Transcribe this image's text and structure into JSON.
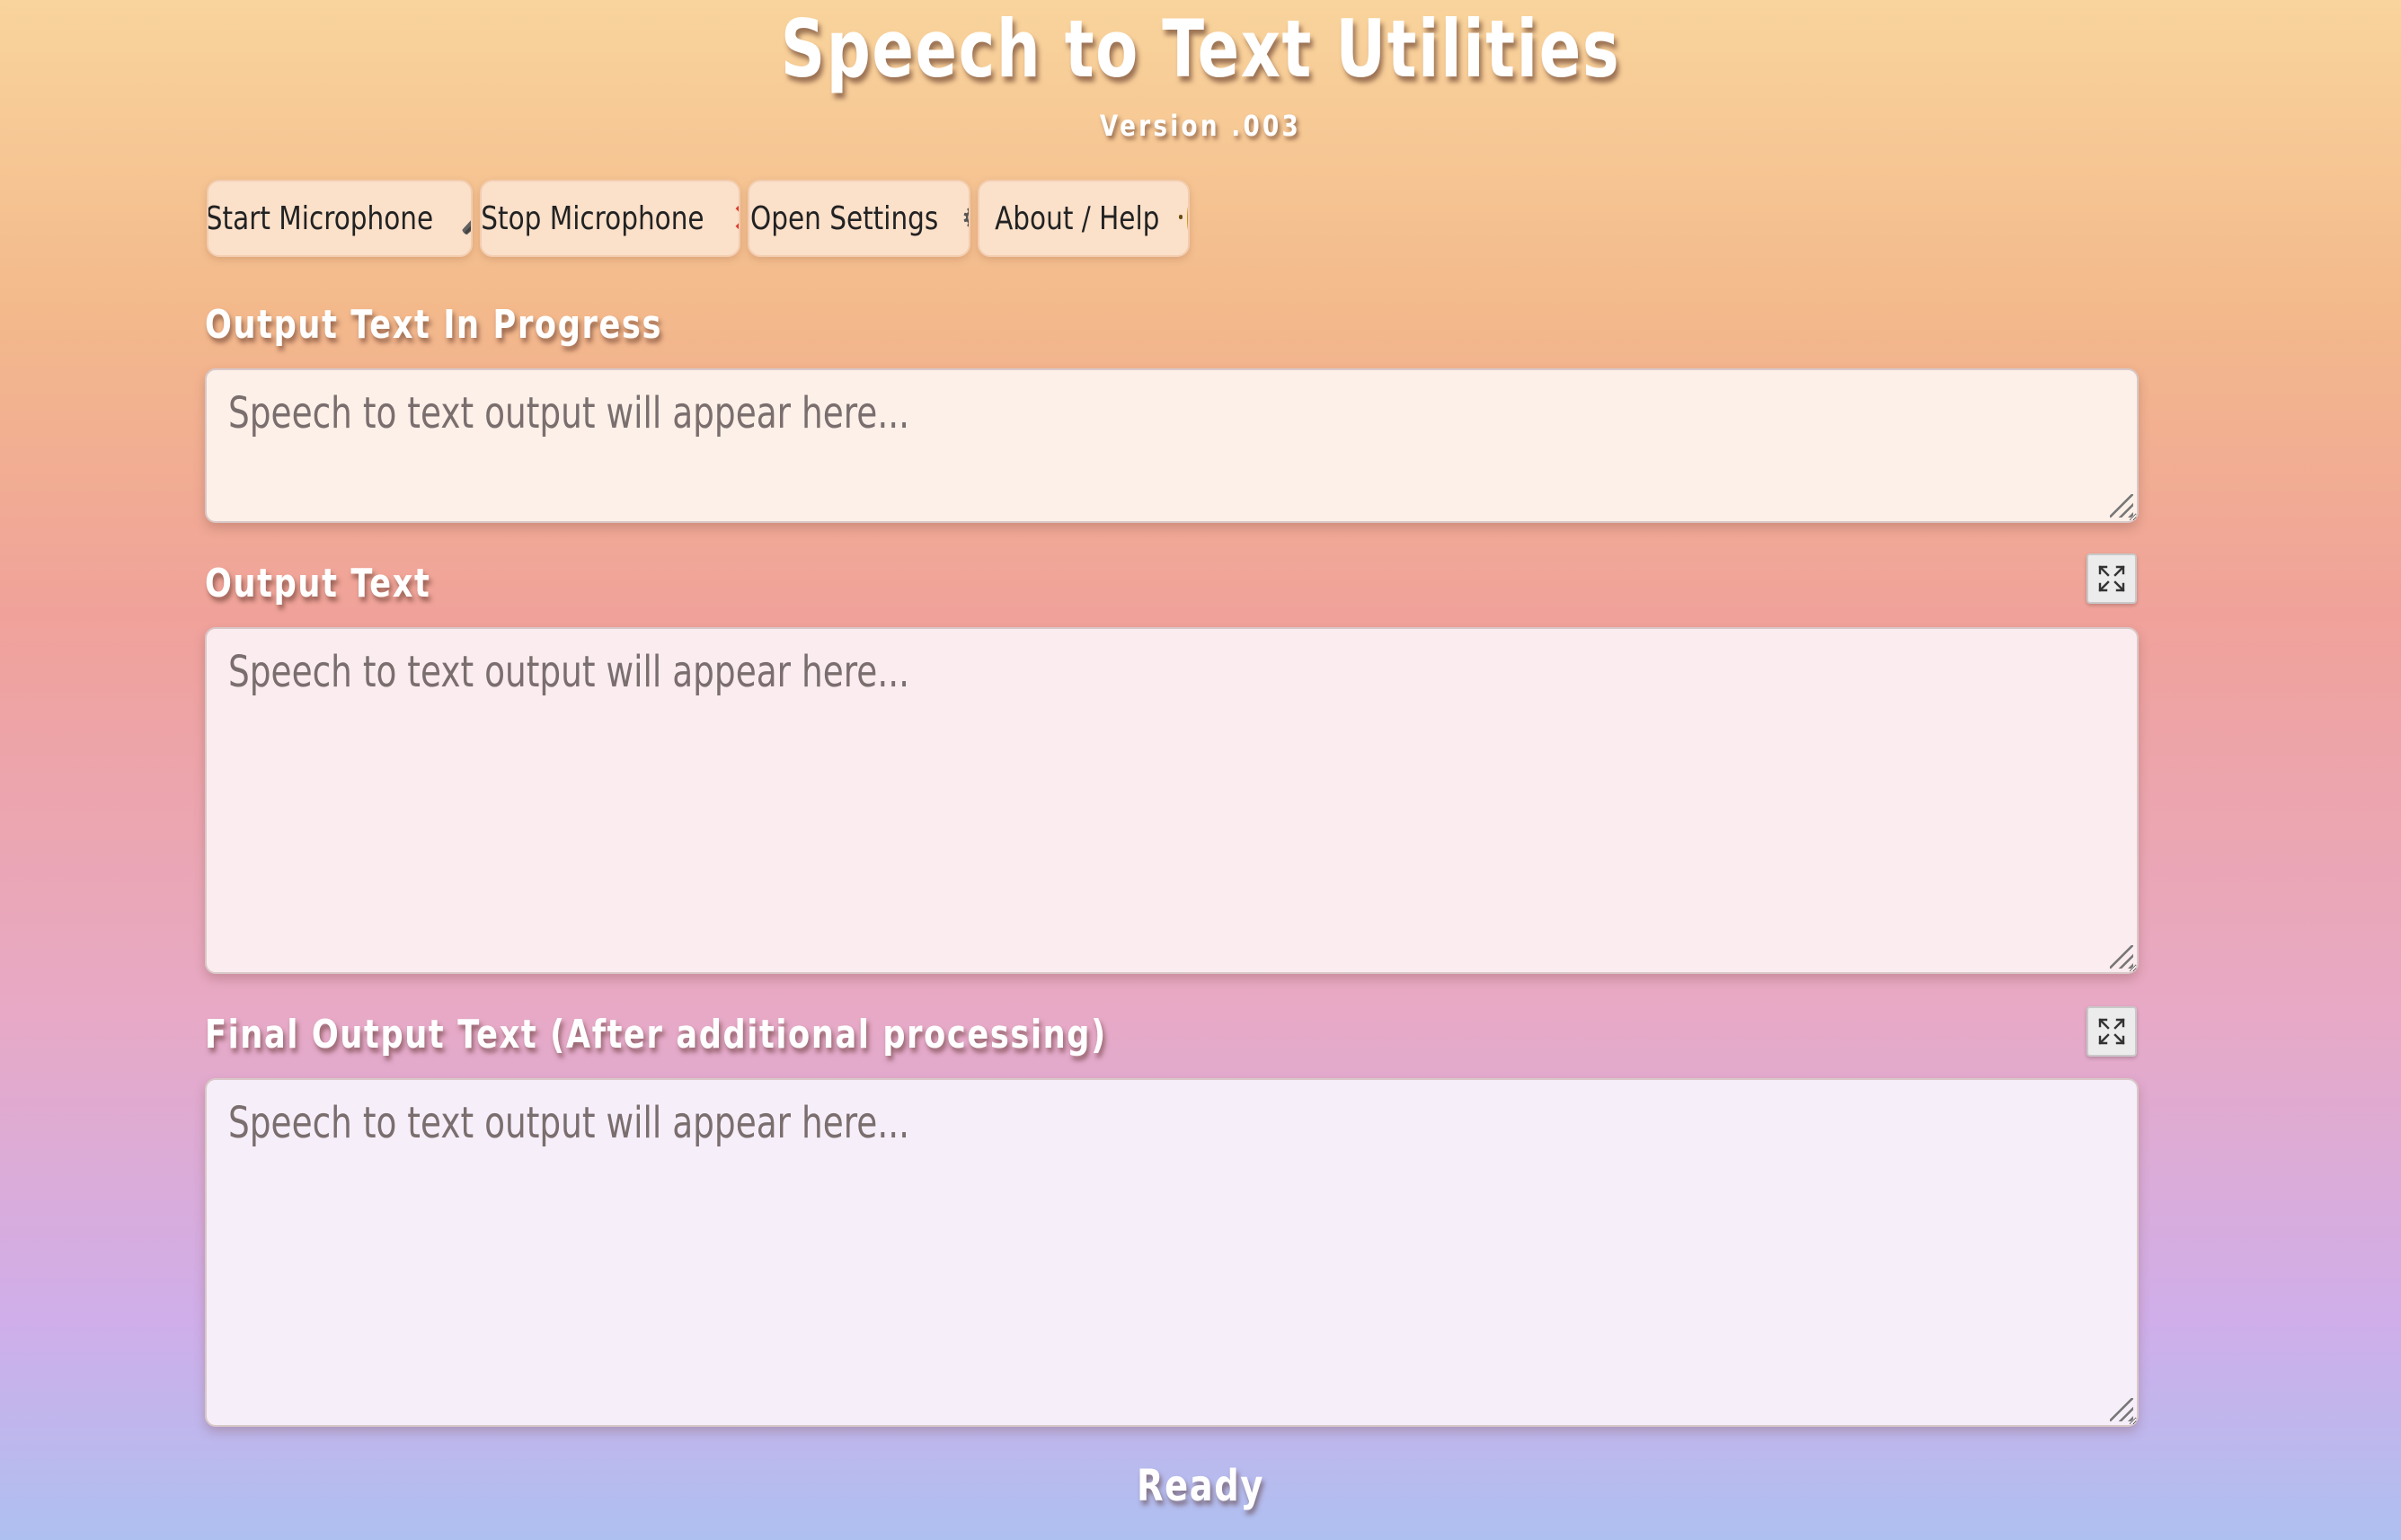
{
  "header": {
    "title": "Speech to Text Utilities",
    "version": "Version .003"
  },
  "toolbar": {
    "buttons": [
      {
        "label": "Start Microphone",
        "icon": "microphone-icon",
        "glyph": "🎤"
      },
      {
        "label": "Stop Microphone",
        "icon": "cross-mark-icon",
        "glyph": "✕"
      },
      {
        "label": "Open Settings",
        "icon": "gear-icon",
        "glyph": "⚙"
      },
      {
        "label": "About / Help",
        "icon": "face-emoji-icon",
        "glyph": ""
      }
    ]
  },
  "sections": [
    {
      "label": "Output Text In Progress",
      "placeholder": "Speech to text output will appear here..."
    },
    {
      "label": "Output Text",
      "placeholder": "Speech to text output will appear here..."
    },
    {
      "label": "Final Output Text (After additional processing)",
      "placeholder": "Speech to text output will appear here..."
    }
  ],
  "status": "Ready",
  "colors": {
    "gradient_top": "#f9d49c",
    "gradient_bottom": "#aec0f0",
    "stop_icon": "#e03b2e",
    "button_bg": "#fbe0ca"
  }
}
